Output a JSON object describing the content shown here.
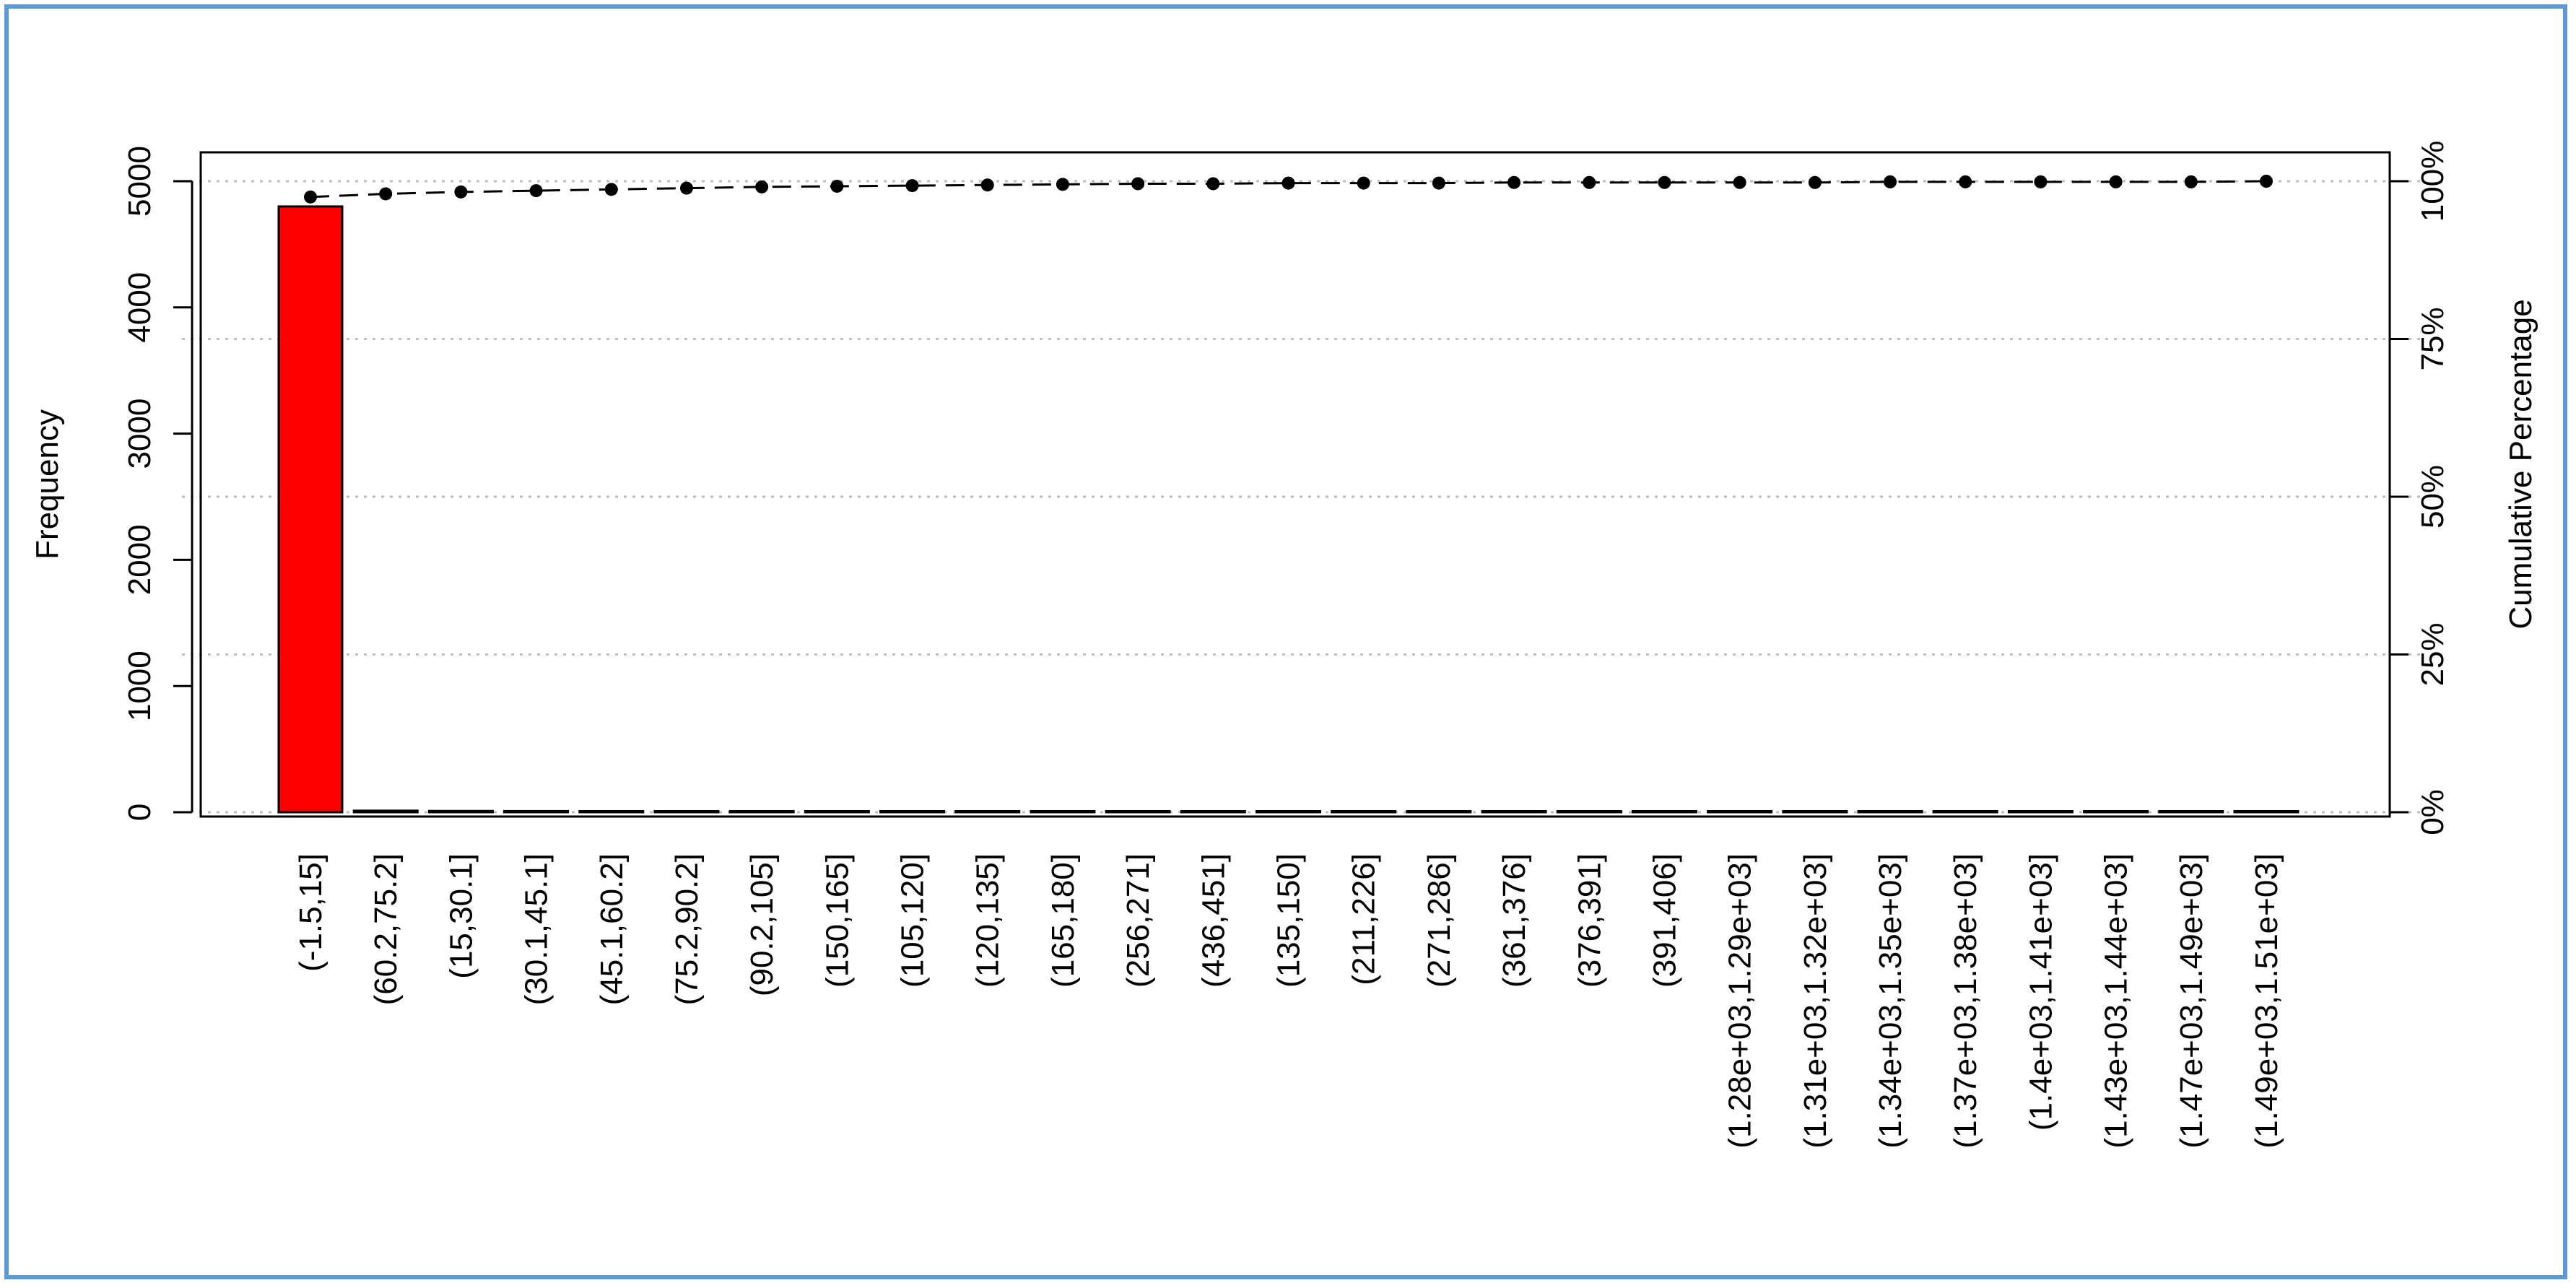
{
  "chart_data": {
    "type": "bar",
    "ylabel": "Frequency",
    "y2label": "Cumulative Percentage",
    "ylim": [
      0,
      5150
    ],
    "yticks": [
      0,
      1000,
      2000,
      3000,
      4000,
      5000
    ],
    "y2ticks": [
      "0%",
      "25%",
      "50%",
      "75%",
      "100%"
    ],
    "grid": true,
    "bar_color": "#ff0000",
    "categories": [
      "(-1.5,15]",
      "(60.2,75.2]",
      "(15,30.1]",
      "(30.1,45.1]",
      "(45.1,60.2]",
      "(75.2,90.2]",
      "(90.2,105]",
      "(150,165]",
      "(105,120]",
      "(120,135]",
      "(165,180]",
      "(256,271]",
      "(436,451]",
      "(135,150]",
      "(211,226]",
      "(271,286]",
      "(361,376]",
      "(376,391]",
      "(391,406]",
      "(1.28e+03,1.29e+03]",
      "(1.31e+03,1.32e+03]",
      "(1.34e+03,1.35e+03]",
      "(1.37e+03,1.38e+03]",
      "(1.4e+03,1.41e+03]",
      "(1.43e+03,1.44e+03]",
      "(1.47e+03,1.49e+03]",
      "(1.49e+03,1.51e+03]"
    ],
    "values": [
      4800,
      12,
      10,
      9,
      8,
      8,
      7,
      6,
      3,
      3,
      3,
      2,
      2,
      2,
      1,
      1,
      1,
      1,
      1,
      1,
      1,
      1,
      1,
      1,
      1,
      1,
      1
    ],
    "cumulative_percent": [
      97.5,
      98.0,
      98.3,
      98.5,
      98.7,
      98.9,
      99.1,
      99.2,
      99.3,
      99.4,
      99.5,
      99.6,
      99.6,
      99.7,
      99.7,
      99.7,
      99.8,
      99.8,
      99.8,
      99.8,
      99.8,
      99.9,
      99.9,
      99.9,
      99.9,
      99.9,
      100
    ]
  }
}
